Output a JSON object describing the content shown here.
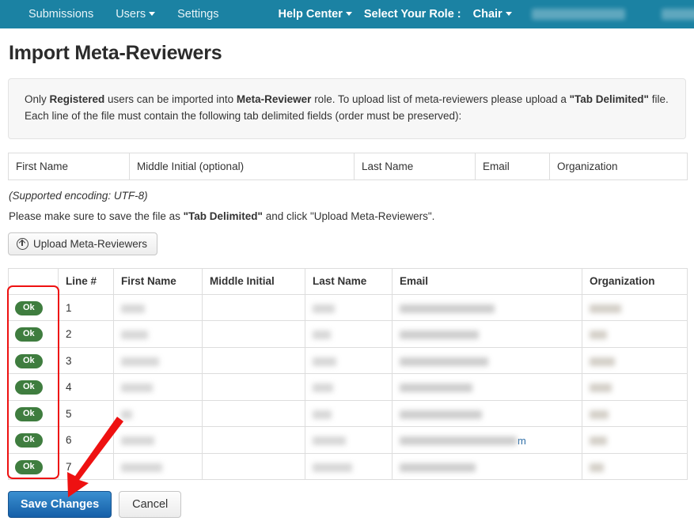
{
  "navbar": {
    "background": "#1b82a3",
    "left_items": [
      {
        "label": "Submissions",
        "caret": false
      },
      {
        "label": "Users",
        "caret": true
      },
      {
        "label": "Settings",
        "caret": false
      }
    ],
    "right_items": [
      {
        "label": "Help Center",
        "caret": true,
        "bold": true
      },
      {
        "label": "Select Your Role :",
        "caret": false,
        "bold": true,
        "static": true
      },
      {
        "label": "Chair",
        "caret": true,
        "bold": true
      }
    ],
    "redacted_user": "",
    "redacted_action": ""
  },
  "page": {
    "title": "Import Meta-Reviewers"
  },
  "info_panel": {
    "line1_a": "Only ",
    "line1_b": "Registered",
    "line1_c": " users can be imported into ",
    "line1_d": "Meta-Reviewer",
    "line1_e": " role. To upload list of meta-reviewers please upload a ",
    "line1_f": "\"Tab Delimited\"",
    "line1_g": " file. Each line of the file must contain the following tab delimited fields (order must be preserved):"
  },
  "format_table": {
    "columns": [
      "First Name",
      "Middle Initial (optional)",
      "Last Name",
      "Email",
      "Organization"
    ]
  },
  "notes": {
    "encoding": "(Supported encoding: UTF-8)",
    "save_a": "Please make sure to save the file as ",
    "save_b": "\"Tab Delimited\"",
    "save_c": " and click \"Upload Meta-Reviewers\"."
  },
  "upload": {
    "label": "Upload Meta-Reviewers",
    "icon": "upload-circle-arrow-icon"
  },
  "data_table": {
    "headers": [
      "",
      "Line #",
      "First Name",
      "Middle Initial",
      "Last Name",
      "Email",
      "Organization"
    ],
    "rows": [
      {
        "status": "Ok",
        "line": "1",
        "first_w": 30,
        "middle_w": 0,
        "last_w": 28,
        "email_w": 120,
        "email_tail": "",
        "org_w": 40
      },
      {
        "status": "Ok",
        "line": "2",
        "first_w": 34,
        "middle_w": 0,
        "last_w": 23,
        "email_w": 100,
        "email_tail": "",
        "org_w": 22
      },
      {
        "status": "Ok",
        "line": "3",
        "first_w": 48,
        "middle_w": 0,
        "last_w": 30,
        "email_w": 112,
        "email_tail": "",
        "org_w": 32
      },
      {
        "status": "Ok",
        "line": "4",
        "first_w": 40,
        "middle_w": 0,
        "last_w": 26,
        "email_w": 92,
        "email_tail": "",
        "org_w": 28
      },
      {
        "status": "Ok",
        "line": "5",
        "first_w": 14,
        "middle_w": 0,
        "last_w": 24,
        "email_w": 104,
        "email_tail": "",
        "org_w": 24
      },
      {
        "status": "Ok",
        "line": "6",
        "first_w": 42,
        "middle_w": 0,
        "last_w": 42,
        "email_w": 148,
        "email_tail": "m",
        "org_w": 22
      },
      {
        "status": "Ok",
        "line": "7",
        "first_w": 52,
        "middle_w": 0,
        "last_w": 50,
        "email_w": 96,
        "email_tail": "",
        "org_w": 18
      }
    ]
  },
  "buttons": {
    "save": "Save Changes",
    "cancel": "Cancel"
  },
  "annotations": {
    "rect_color": "#ee1111",
    "arrow_color": "#ee1111",
    "rect_target": "status-column",
    "arrow_target": "save-changes-button"
  }
}
